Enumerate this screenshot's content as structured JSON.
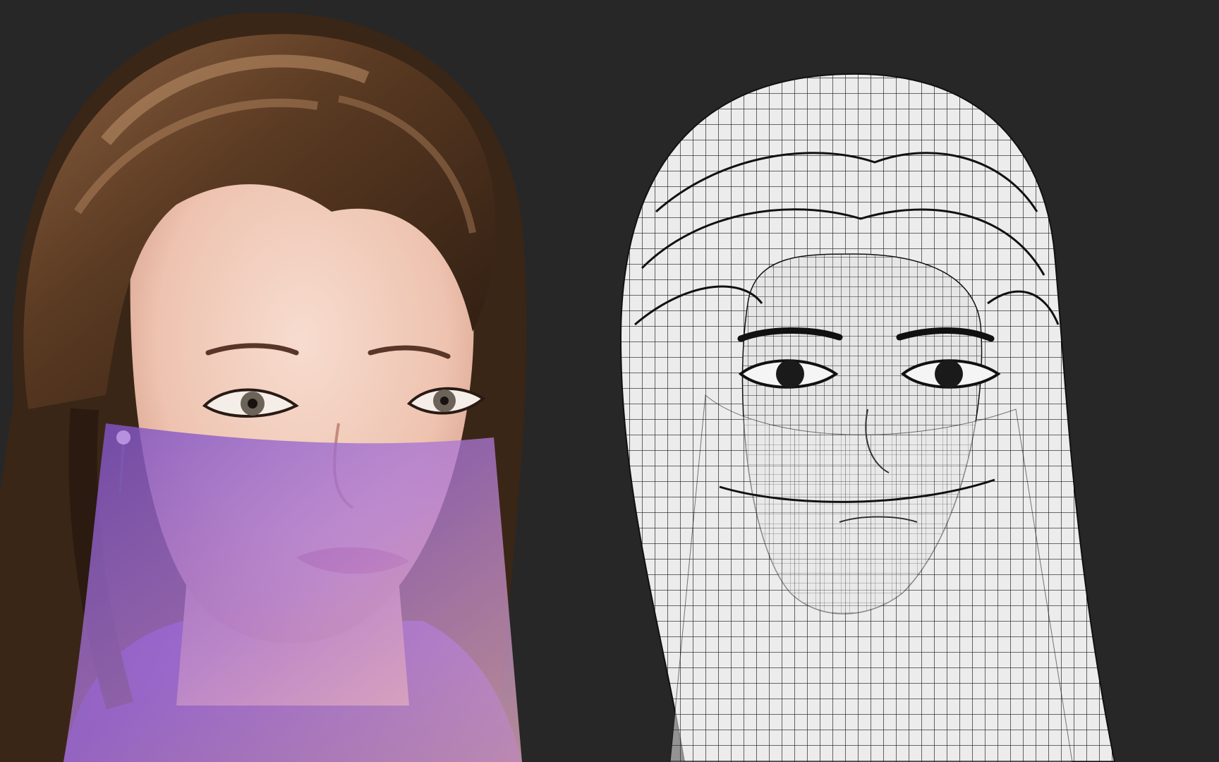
{
  "scene": {
    "background_color": "#272727",
    "left_panel": {
      "subject": "rendered-3d-character-portrait",
      "hair_color": "#5a3a22",
      "skin_color": "#f1c9b8",
      "veil_color": "#8a5fc9"
    },
    "right_panel": {
      "subject": "wireframe-mesh-character-head",
      "mesh_fill": "#e9e9e9",
      "line_color": "#1a1a1a"
    }
  }
}
